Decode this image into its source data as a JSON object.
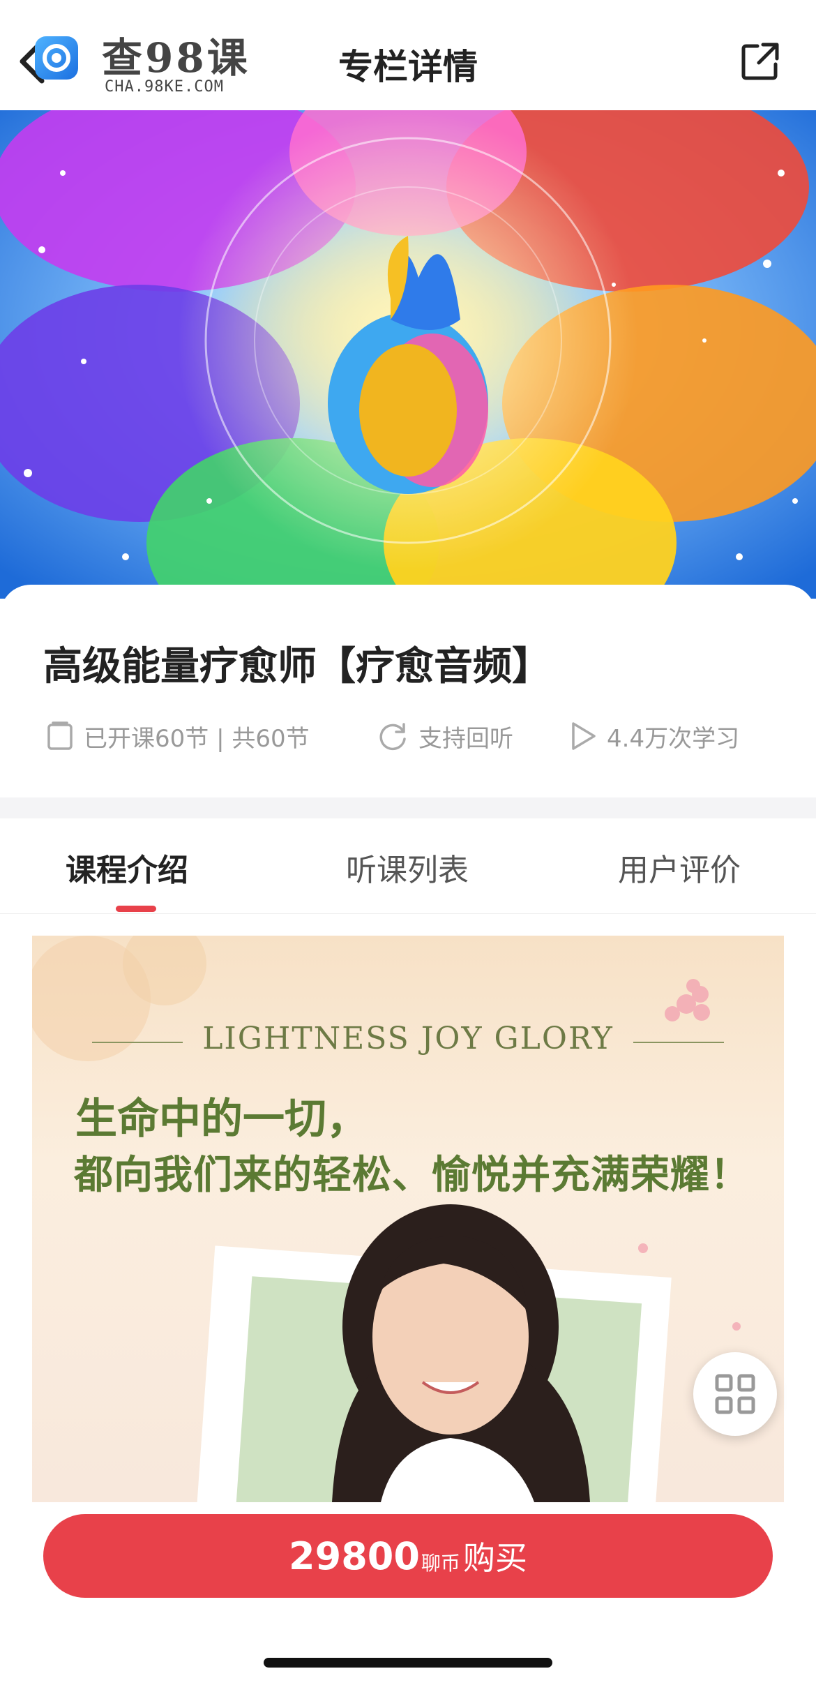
{
  "header": {
    "logo_cn": "查98课",
    "logo_en": "CHA.98KE.COM",
    "title": "专栏详情",
    "icons": {
      "back": "chevron-left-icon",
      "share": "external-share-icon"
    }
  },
  "course": {
    "title": "高级能量疗愈师【疗愈音频】",
    "meta": {
      "lessons": "已开课60节 | 共60节",
      "replay": "支持回听",
      "views": "4.4万次学习"
    }
  },
  "tabs": [
    {
      "label": "课程介绍",
      "active": true
    },
    {
      "label": "听课列表",
      "active": false
    },
    {
      "label": "用户评价",
      "active": false
    }
  ],
  "poster": {
    "en": "LIGHTNESS JOY GLORY",
    "line1": "生命中的一切，",
    "line2": "都向我们来的轻松、愉悦并充满荣耀！"
  },
  "buy": {
    "price": "29800",
    "unit": "聊币",
    "label": "购买"
  },
  "colors": {
    "accent": "#e8414a",
    "muted": "#999999",
    "poster_text": "#5b7a33"
  }
}
